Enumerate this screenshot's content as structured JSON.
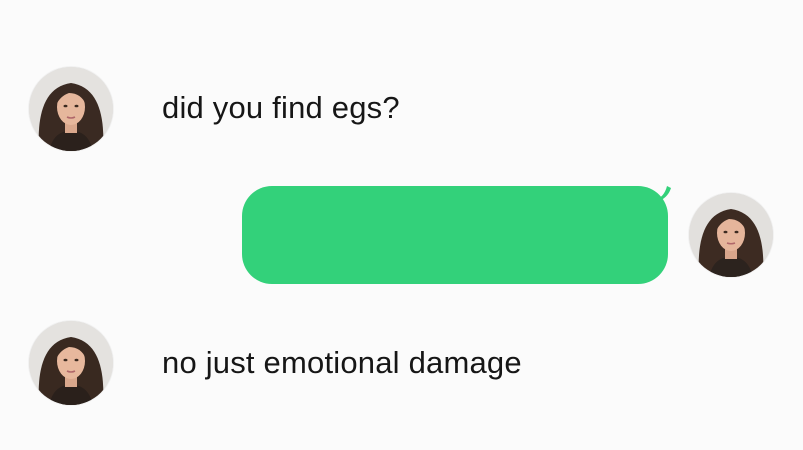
{
  "conversation": {
    "messages": [
      {
        "sender": "incoming",
        "text": "did you find egs?"
      },
      {
        "sender": "outgoing",
        "text": ""
      },
      {
        "sender": "incoming",
        "text": "no just emotional damage"
      }
    ]
  },
  "colors": {
    "background": "#fbfbfb",
    "outgoing_bubble": "#33d17a",
    "text": "#161616"
  },
  "icons": {
    "avatar": "user-portrait-photo"
  }
}
